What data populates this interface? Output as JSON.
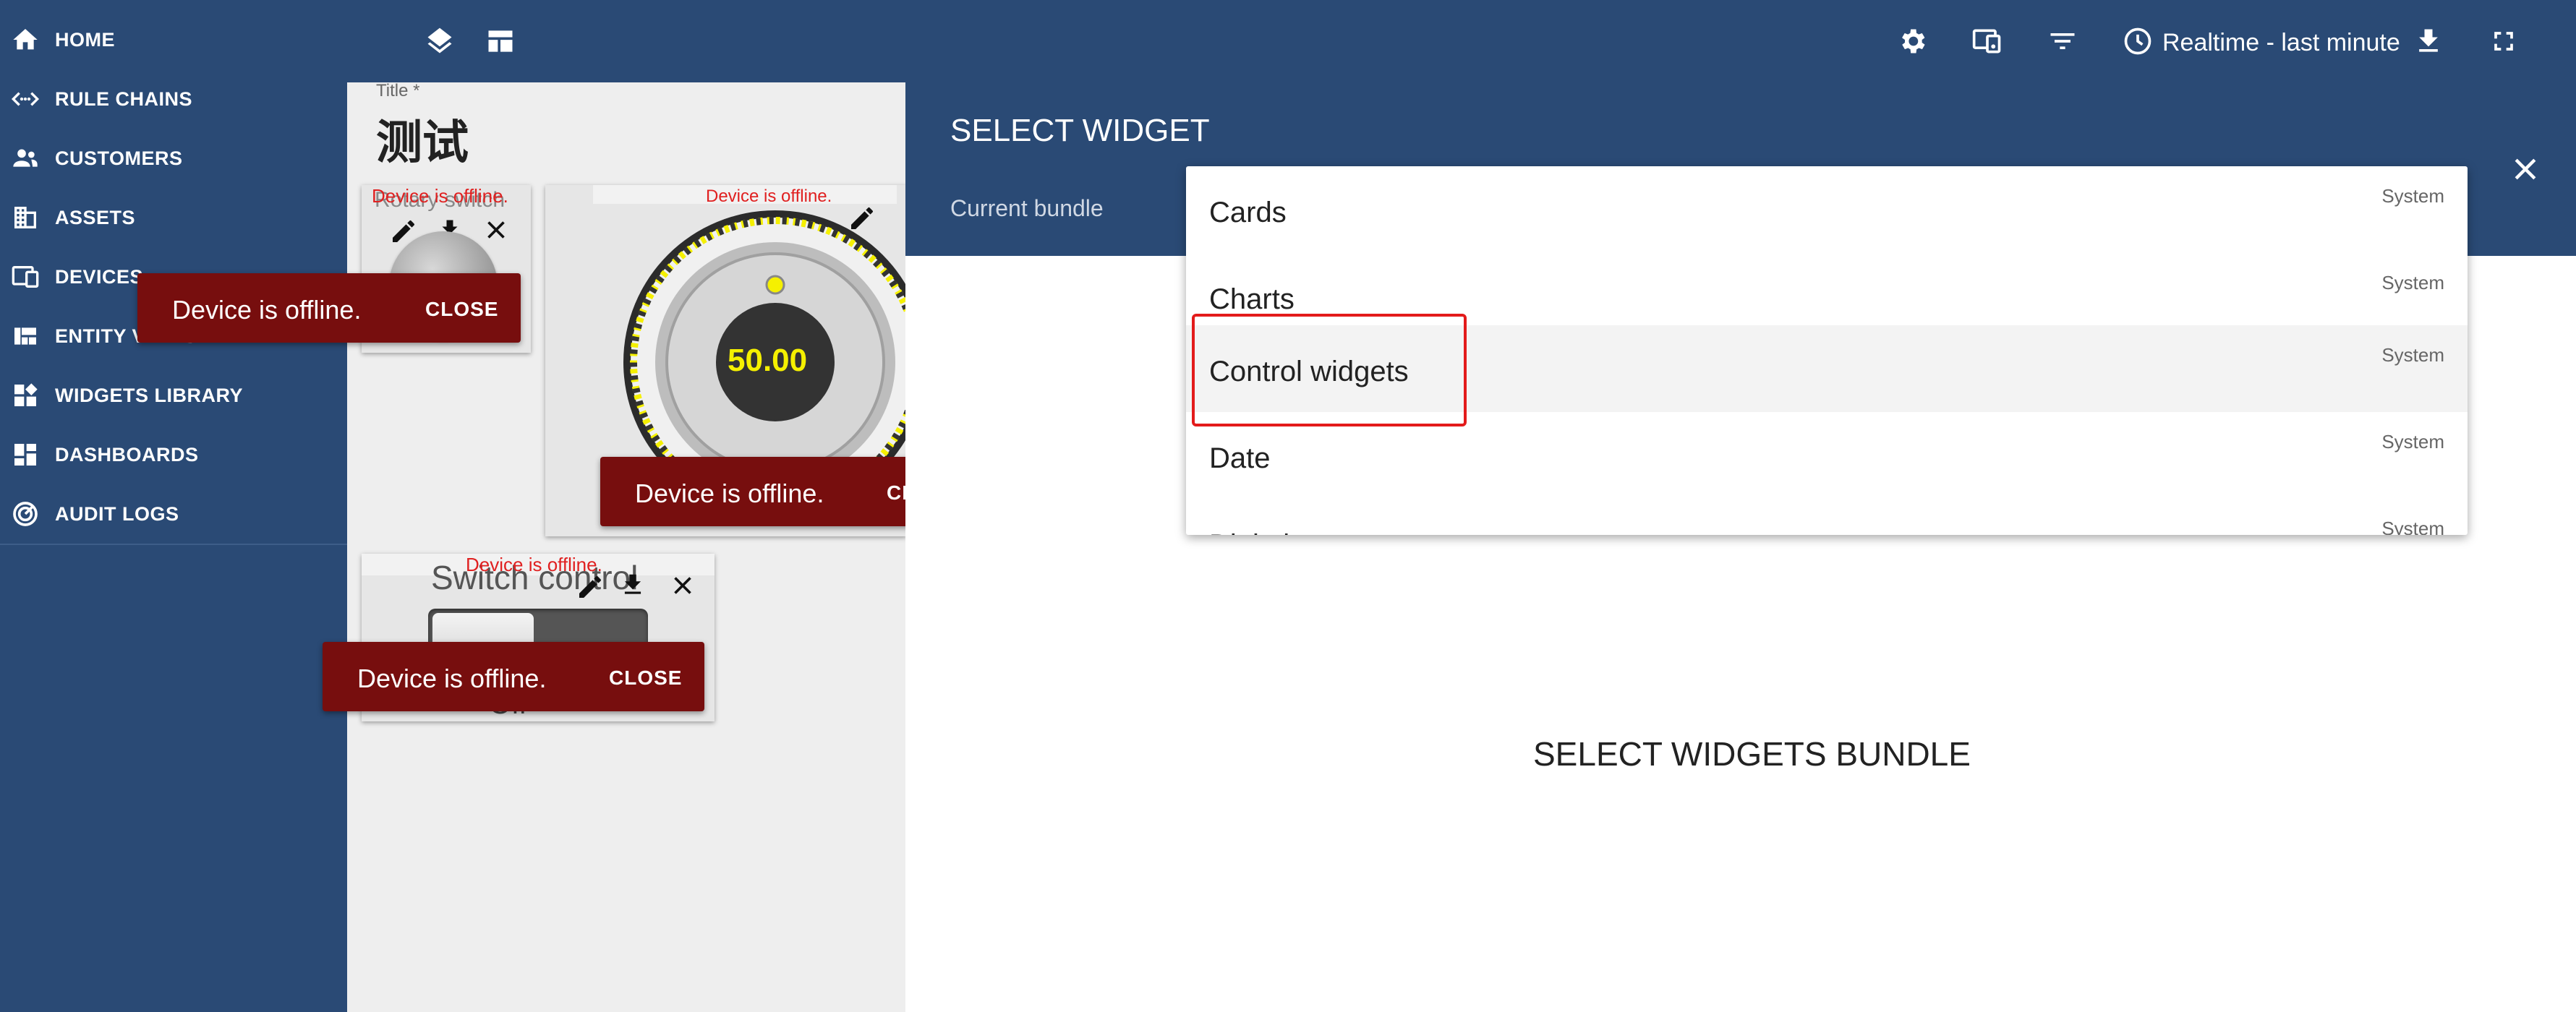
{
  "sidebar": {
    "items": [
      {
        "label": "HOME",
        "icon": "home-icon"
      },
      {
        "label": "RULE CHAINS",
        "icon": "code-arrows-icon"
      },
      {
        "label": "CUSTOMERS",
        "icon": "people-icon"
      },
      {
        "label": "ASSETS",
        "icon": "building-icon"
      },
      {
        "label": "DEVICES",
        "icon": "devices-icon"
      },
      {
        "label": "ENTITY VIEWS",
        "icon": "view-quilt-icon"
      },
      {
        "label": "WIDGETS LIBRARY",
        "icon": "widgets-icon"
      },
      {
        "label": "DASHBOARDS",
        "icon": "dashboard-icon"
      },
      {
        "label": "AUDIT LOGS",
        "icon": "track-changes-icon"
      }
    ]
  },
  "topbar": {
    "realtime_label": "Realtime - last minute",
    "icons": [
      "layers-icon",
      "layout-icon",
      "settings-icon",
      "devices-icon",
      "filter-icon",
      "clock-icon",
      "download-icon",
      "fullscreen-icon"
    ]
  },
  "dashboard": {
    "title_label": "Title *",
    "title_value": "测试",
    "widgets": {
      "rotary_switch": {
        "title": "Rotary switch",
        "offline": "Device is offline."
      },
      "knob": {
        "value": "50.00",
        "offline": "Device is offline."
      },
      "switch_control": {
        "title": "Switch control",
        "offline": "Device is offline.",
        "footer": "Off"
      }
    }
  },
  "toasts": [
    {
      "message": "Device is offline.",
      "close": "CLOSE"
    },
    {
      "message": "Device is offline.",
      "close": "CLOSE"
    },
    {
      "message": "Device is offline.",
      "close": "CLOSE"
    }
  ],
  "panel": {
    "title": "SELECT WIDGET",
    "current_bundle_label": "Current bundle",
    "empty_message": "SELECT WIDGETS BUNDLE",
    "options": [
      {
        "name": "Cards",
        "tag": "System"
      },
      {
        "name": "Charts",
        "tag": "System"
      },
      {
        "name": "Control widgets",
        "tag": "System"
      },
      {
        "name": "Date",
        "tag": "System"
      },
      {
        "name": "Digital gauges",
        "tag": "System"
      }
    ]
  },
  "colors": {
    "primary": "#2a4a75",
    "toast": "#770e0e",
    "highlight_border": "#e31b1b",
    "offline_text": "#e02020",
    "knob_value": "#f5f000"
  }
}
